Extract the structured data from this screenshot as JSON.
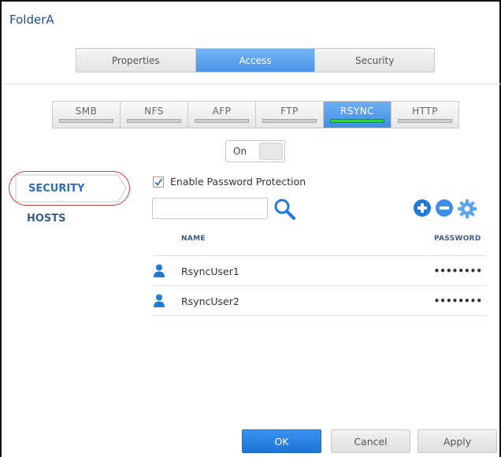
{
  "window": {
    "title": "FolderA"
  },
  "main_tabs": [
    {
      "label": "Properties",
      "active": false
    },
    {
      "label": "Access",
      "active": true
    },
    {
      "label": "Security",
      "active": false
    }
  ],
  "protocol_tabs": [
    {
      "label": "SMB",
      "active": false
    },
    {
      "label": "NFS",
      "active": false
    },
    {
      "label": "AFP",
      "active": false
    },
    {
      "label": "FTP",
      "active": false
    },
    {
      "label": "RSYNC",
      "active": true
    },
    {
      "label": "HTTP",
      "active": false
    }
  ],
  "toggle": {
    "label": "On"
  },
  "sidebar": {
    "items": [
      {
        "label": "SECURITY",
        "selected": true
      },
      {
        "label": "HOSTS",
        "selected": false
      }
    ]
  },
  "security": {
    "enable_password_label": "Enable Password Protection",
    "enable_password_checked": true,
    "search_value": "",
    "icons": [
      "search-icon",
      "add-icon",
      "remove-icon",
      "settings-icon"
    ]
  },
  "table": {
    "headers": {
      "name": "NAME",
      "password": "PASSWORD"
    },
    "rows": [
      {
        "name": "RsyncUser1",
        "password": "••••••••"
      },
      {
        "name": "RsyncUser2",
        "password": "••••••••"
      }
    ]
  },
  "footer": {
    "ok_label": "OK",
    "cancel_label": "Cancel",
    "apply_label": "Apply"
  },
  "colors": {
    "accent_blue": "#4a94e6",
    "active_indicator_green": "#33d13e",
    "highlight_ring": "#d63a3a",
    "title_blue": "#1f4e8c"
  }
}
